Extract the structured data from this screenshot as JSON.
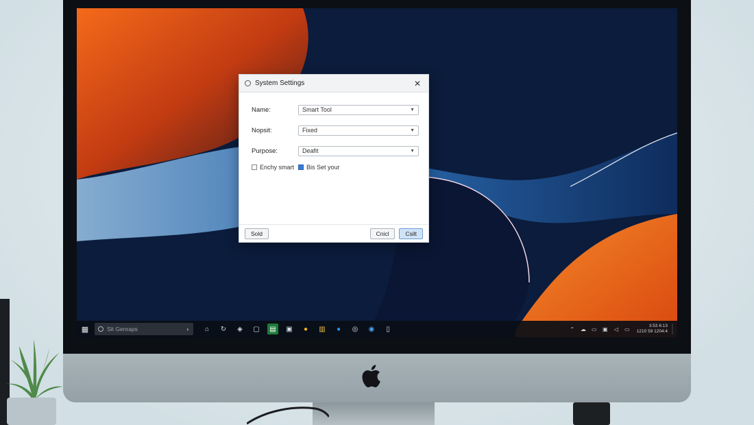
{
  "dialog": {
    "title": "System Settings",
    "fields": [
      {
        "label": "Name:",
        "value": "Smart Tool"
      },
      {
        "label": "Nopsit:",
        "value": "Fixed"
      },
      {
        "label": "Purpose:",
        "value": "Deafit"
      }
    ],
    "checkboxes": [
      {
        "label": "Enchy smart",
        "checked": false
      },
      {
        "label": "Bis Set your",
        "checked": true
      }
    ],
    "buttons": {
      "left": "Sold",
      "cancel": "Cnicl",
      "ok": "Csilt"
    }
  },
  "taskbar": {
    "search_placeholder": "Sit Genraps",
    "apps": [
      "bell-icon",
      "refresh-icon",
      "shield-icon",
      "chat-icon",
      "excel-icon",
      "monitor-icon",
      "chrome-icon",
      "store-icon",
      "edge-icon",
      "circle-icon",
      "settings-icon",
      "document-icon"
    ],
    "tray": [
      "arrow-up-icon",
      "cloud-icon",
      "network-icon",
      "camera-icon",
      "volume-icon",
      "battery-icon"
    ],
    "clock_time": "3:53 6:13",
    "clock_date": "1210 59 1204:4"
  },
  "colors": {
    "accent": "#3a7bd5",
    "wallpaper_orange": "#f05a14",
    "wallpaper_blue": "#1e5ea8",
    "taskbar": "#0e1218"
  }
}
